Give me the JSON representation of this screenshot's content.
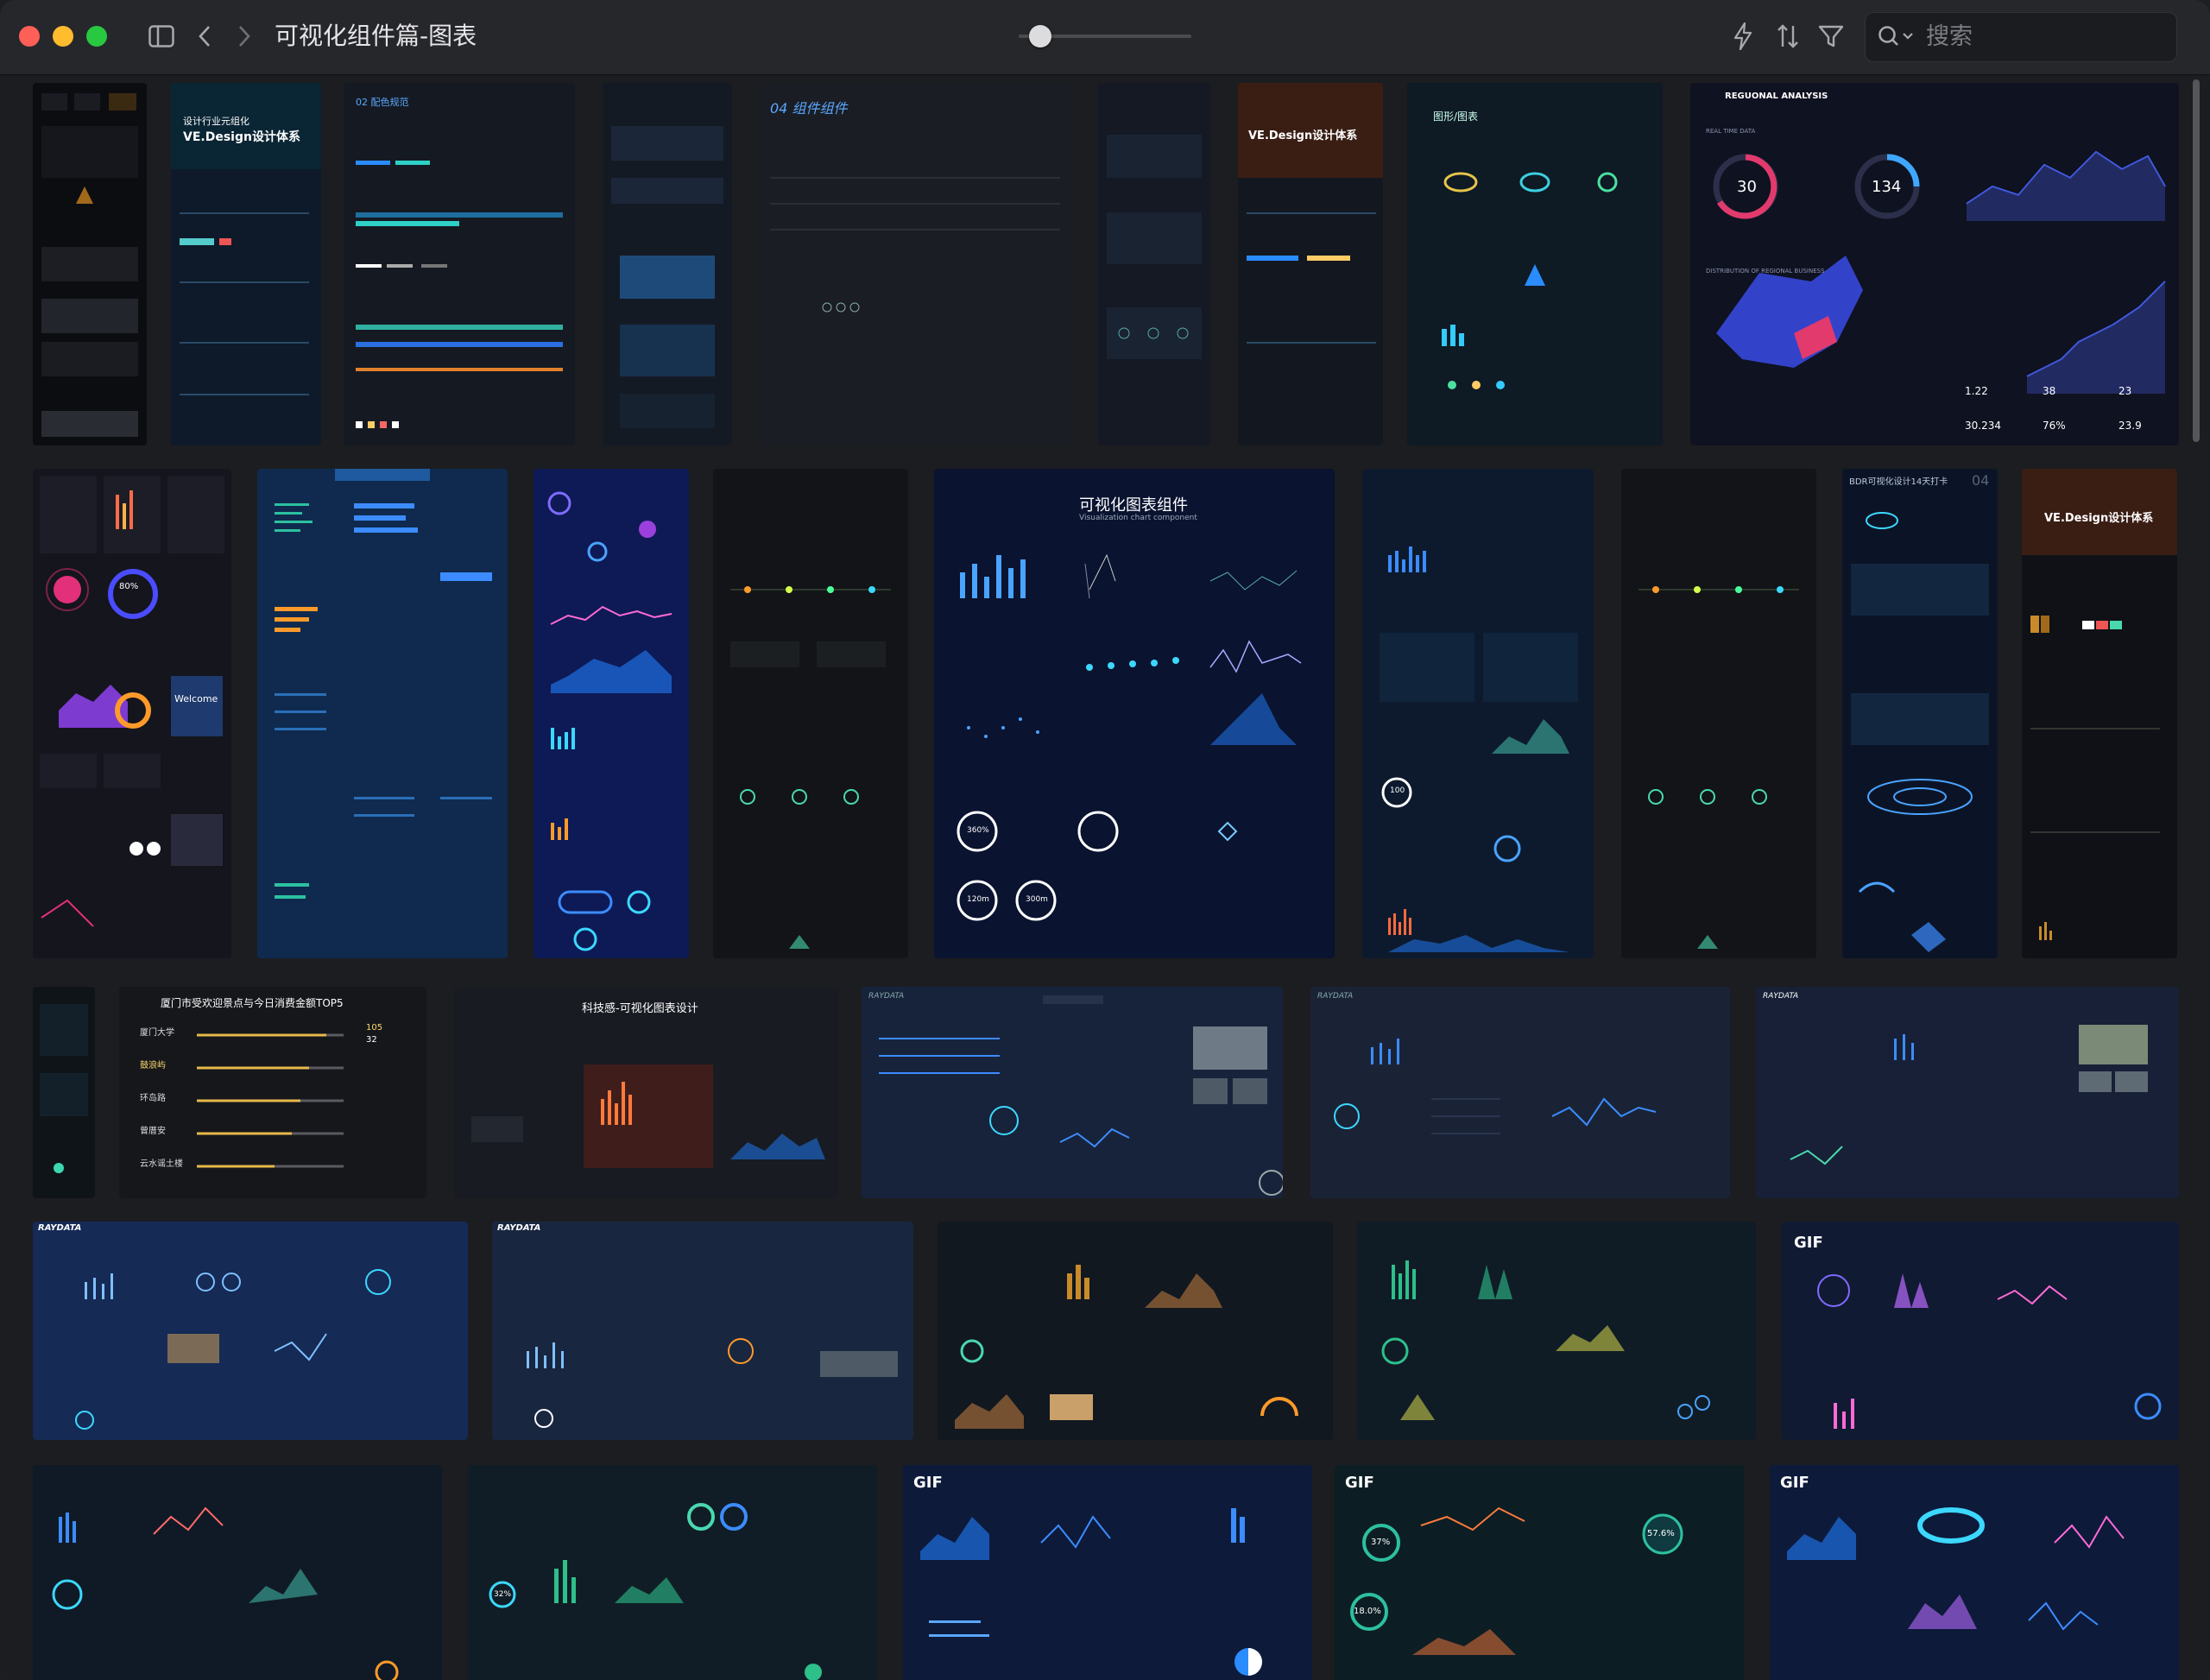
{
  "window": {
    "title": "可视化组件篇-图表",
    "search_placeholder": "搜索",
    "traffic_lights": [
      "#fe5f57",
      "#febc2e",
      "#28c840"
    ]
  },
  "toolbar": {
    "icons": [
      "sidebar-toggle-icon",
      "back-icon",
      "forward-icon",
      "bolt-icon",
      "sort-icon",
      "filter-icon",
      "search-icon"
    ]
  },
  "thumbs": {
    "t2_brand": "VE.Design设计体系",
    "t2_sub": "设计行业元组化",
    "t3_label": "02 配色规范",
    "t5_label": "04 组件组件",
    "t7_brand": "VE.Design设计体系",
    "t8_label": "图形/图表",
    "t9_title": "REGUONAL ANALYSIS",
    "t9_subtitle": "REAL TIME DATA",
    "t9_g1": "30",
    "t9_g2": "134",
    "t9_s1": "1.22",
    "t9_s2": "38",
    "t9_s3": "23",
    "t9_s4": "30.234",
    "t9_s5": "76%",
    "t9_s6": "23.9",
    "t9_section": "DISTRIBUTION OF REGIONAL BUSINESS",
    "r2_welcome": "Welcome",
    "r2_pct": "80%",
    "r2_main_title": "可视化图表组件",
    "r2_main_sub": "Visualization chart component",
    "r2_main_v1": "360%",
    "r2_main_v2": "120m",
    "r2_main_v3": "300m",
    "r2_c100": "100",
    "r2_bdr": "BDR可视化设计14天打卡",
    "r2_bdr_num": "04",
    "r2_ve": "VE.Design设计体系",
    "r3_rank_title": "厦门市受欢迎景点与今日消费金额TOP5",
    "r3_rank_items": [
      "厦门大学",
      "鼓浪屿",
      "环岛路",
      "曾厝安",
      "云水谣土楼"
    ],
    "r3_rank_v1": "105",
    "r3_rank_v2": "32",
    "r3_tech_title": "科技感-可视化图表设计",
    "r3_raydata": "RAYDATA",
    "r5_gif": "GIF",
    "r5_pct1": "37%",
    "r5_pct2": "18.0%",
    "r5_pct3": "32%",
    "r5_pct4": "57.6%"
  }
}
